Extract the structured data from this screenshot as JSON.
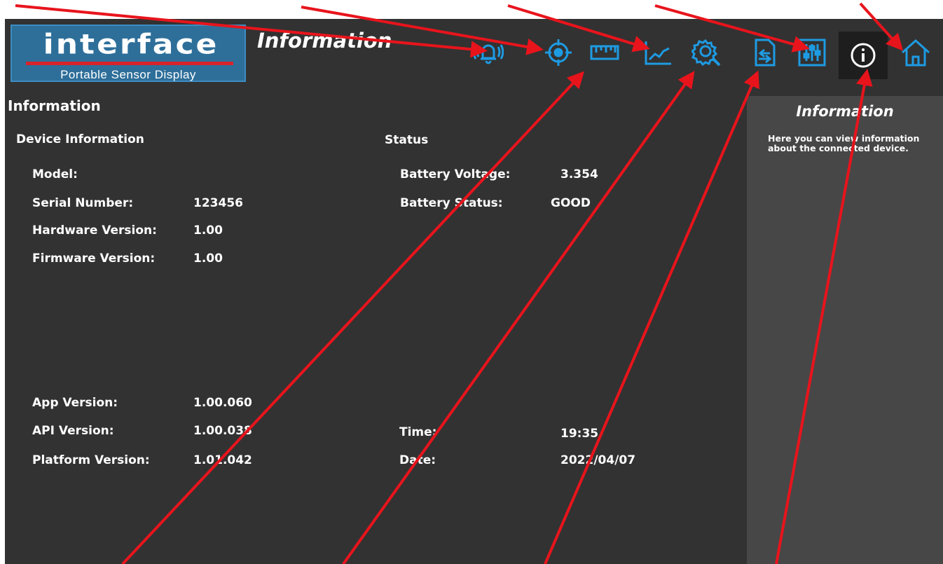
{
  "header": {
    "logo_main": "interface",
    "logo_sub": "Portable Sensor Display",
    "title": "Information"
  },
  "toolbar": {
    "active": "info",
    "items": [
      {
        "name": "alarm-icon",
        "label": "alarm"
      },
      {
        "name": "target-icon",
        "label": "tare"
      },
      {
        "name": "ruler-icon",
        "label": "units"
      },
      {
        "name": "chart-icon",
        "label": "graph"
      },
      {
        "name": "settings-icon",
        "label": "settings"
      },
      {
        "name": "file-transfer-icon",
        "label": "data"
      },
      {
        "name": "sliders-icon",
        "label": "adjust"
      },
      {
        "name": "info-icon",
        "label": "info"
      },
      {
        "name": "home-icon",
        "label": "home"
      }
    ],
    "accent_color": "#1e9be3"
  },
  "main": {
    "section_title": "Information",
    "device": {
      "heading": "Device Information",
      "model_label": "Model:",
      "model_value": "",
      "serial_label": "Serial Number:",
      "serial_value": "123456",
      "hardware_label": "Hardware Version:",
      "hardware_value": "1.00",
      "firmware_label": "Firmware Version:",
      "firmware_value": "1.00",
      "app_label": "App Version:",
      "app_value": "1.00.060",
      "api_label": "API Version:",
      "api_value": "1.00.038",
      "platform_label": "Platform Version:",
      "platform_value": "1.01.042"
    },
    "status": {
      "heading": "Status",
      "battery_voltage_label": "Battery Voltage:",
      "battery_voltage_value": "3.354",
      "battery_status_label": "Battery Status:",
      "battery_status_value": "GOOD",
      "time_label": "Time:",
      "time_value": "19:35",
      "date_label": "Date:",
      "date_value": "2022/04/07"
    }
  },
  "help_panel": {
    "title": "Information",
    "text": "Here you can view information about the connected device."
  },
  "colors": {
    "background": "#323232",
    "panel": "#474747",
    "annotation_arrow": "#e8141c"
  }
}
